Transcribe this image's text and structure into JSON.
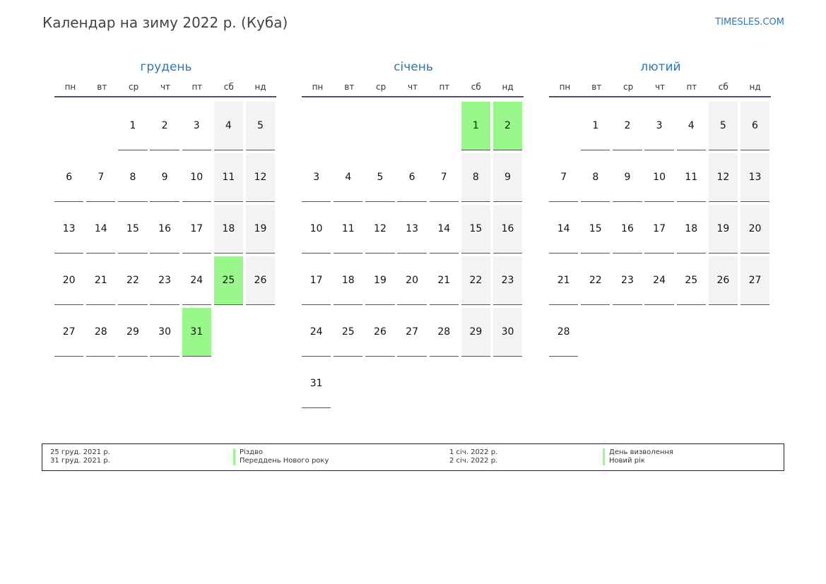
{
  "header": {
    "title": "Календар на зиму 2022 р. (Куба)",
    "brand": "TIMESLES.COM"
  },
  "weekdays": [
    "пн",
    "вт",
    "ср",
    "чт",
    "пт",
    "сб",
    "нд"
  ],
  "months": [
    {
      "name": "грудень",
      "weeks": [
        [
          {
            "d": ""
          },
          {
            "d": ""
          },
          {
            "d": "1"
          },
          {
            "d": "2"
          },
          {
            "d": "3"
          },
          {
            "d": "4",
            "t": "w"
          },
          {
            "d": "5",
            "t": "w"
          }
        ],
        [
          {
            "d": "6"
          },
          {
            "d": "7"
          },
          {
            "d": "8"
          },
          {
            "d": "9"
          },
          {
            "d": "10"
          },
          {
            "d": "11",
            "t": "w"
          },
          {
            "d": "12",
            "t": "w"
          }
        ],
        [
          {
            "d": "13"
          },
          {
            "d": "14"
          },
          {
            "d": "15"
          },
          {
            "d": "16"
          },
          {
            "d": "17"
          },
          {
            "d": "18",
            "t": "w"
          },
          {
            "d": "19",
            "t": "w"
          }
        ],
        [
          {
            "d": "20"
          },
          {
            "d": "21"
          },
          {
            "d": "22"
          },
          {
            "d": "23"
          },
          {
            "d": "24"
          },
          {
            "d": "25",
            "t": "h"
          },
          {
            "d": "26",
            "t": "w"
          }
        ],
        [
          {
            "d": "27"
          },
          {
            "d": "28"
          },
          {
            "d": "29"
          },
          {
            "d": "30"
          },
          {
            "d": "31",
            "t": "h"
          },
          {
            "d": ""
          },
          {
            "d": ""
          }
        ]
      ]
    },
    {
      "name": "січень",
      "weeks": [
        [
          {
            "d": ""
          },
          {
            "d": ""
          },
          {
            "d": ""
          },
          {
            "d": ""
          },
          {
            "d": ""
          },
          {
            "d": "1",
            "t": "h"
          },
          {
            "d": "2",
            "t": "h"
          }
        ],
        [
          {
            "d": "3"
          },
          {
            "d": "4"
          },
          {
            "d": "5"
          },
          {
            "d": "6"
          },
          {
            "d": "7"
          },
          {
            "d": "8",
            "t": "w"
          },
          {
            "d": "9",
            "t": "w"
          }
        ],
        [
          {
            "d": "10"
          },
          {
            "d": "11"
          },
          {
            "d": "12"
          },
          {
            "d": "13"
          },
          {
            "d": "14"
          },
          {
            "d": "15",
            "t": "w"
          },
          {
            "d": "16",
            "t": "w"
          }
        ],
        [
          {
            "d": "17"
          },
          {
            "d": "18"
          },
          {
            "d": "19"
          },
          {
            "d": "20"
          },
          {
            "d": "21"
          },
          {
            "d": "22",
            "t": "w"
          },
          {
            "d": "23",
            "t": "w"
          }
        ],
        [
          {
            "d": "24"
          },
          {
            "d": "25"
          },
          {
            "d": "26"
          },
          {
            "d": "27"
          },
          {
            "d": "28"
          },
          {
            "d": "29",
            "t": "w"
          },
          {
            "d": "30",
            "t": "w"
          }
        ],
        [
          {
            "d": "31"
          },
          {
            "d": ""
          },
          {
            "d": ""
          },
          {
            "d": ""
          },
          {
            "d": ""
          },
          {
            "d": ""
          },
          {
            "d": ""
          }
        ]
      ]
    },
    {
      "name": "лютий",
      "weeks": [
        [
          {
            "d": ""
          },
          {
            "d": "1"
          },
          {
            "d": "2"
          },
          {
            "d": "3"
          },
          {
            "d": "4"
          },
          {
            "d": "5",
            "t": "w"
          },
          {
            "d": "6",
            "t": "w"
          }
        ],
        [
          {
            "d": "7"
          },
          {
            "d": "8"
          },
          {
            "d": "9"
          },
          {
            "d": "10"
          },
          {
            "d": "11"
          },
          {
            "d": "12",
            "t": "w"
          },
          {
            "d": "13",
            "t": "w"
          }
        ],
        [
          {
            "d": "14"
          },
          {
            "d": "15"
          },
          {
            "d": "16"
          },
          {
            "d": "17"
          },
          {
            "d": "18"
          },
          {
            "d": "19",
            "t": "w"
          },
          {
            "d": "20",
            "t": "w"
          }
        ],
        [
          {
            "d": "21"
          },
          {
            "d": "22"
          },
          {
            "d": "23"
          },
          {
            "d": "24"
          },
          {
            "d": "25"
          },
          {
            "d": "26",
            "t": "w"
          },
          {
            "d": "27",
            "t": "w"
          }
        ],
        [
          {
            "d": "28"
          },
          {
            "d": ""
          },
          {
            "d": ""
          },
          {
            "d": ""
          },
          {
            "d": ""
          },
          {
            "d": ""
          },
          {
            "d": ""
          }
        ]
      ]
    }
  ],
  "legend": {
    "left_dates": [
      "25 груд. 2021 р.",
      "31 груд. 2021 р."
    ],
    "left_names": [
      "Різдво",
      "Переддень Нового року"
    ],
    "right_dates": [
      "1 січ. 2022 р.",
      "2 січ. 2022 р."
    ],
    "right_names": [
      "День визволення",
      "Новий рік"
    ]
  },
  "colors": {
    "holiday": "#98f98a",
    "weekend": "#f3f3f3",
    "accent": "#2a7ab9"
  }
}
